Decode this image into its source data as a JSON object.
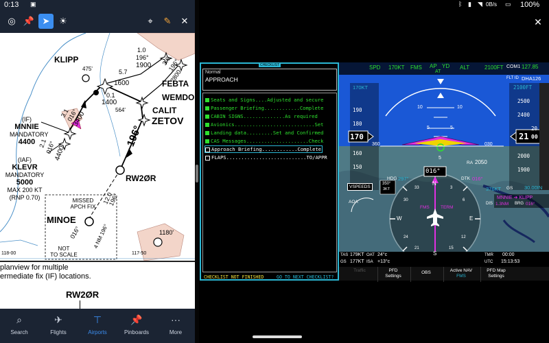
{
  "status_left": {
    "time": "0:13"
  },
  "status_right": {
    "speed": "0B/s",
    "battery": "100%"
  },
  "chart": {
    "fixes": {
      "klipp": "KLIPP",
      "febta": "FEBTA",
      "wemdo": "WEMDO",
      "calit": "CALIT",
      "zetov": "ZETOV",
      "mnnie": "MNNIE",
      "klevr": "KLEVR",
      "minoe": "MINOE",
      "rw20r": "RW2ØR"
    },
    "mnnie_block": {
      "if": "(IF)",
      "name": "MNNIE",
      "mandatory": "MANDATORY",
      "alt": "4400"
    },
    "klevr_block": {
      "iaf": "(IAF)",
      "name": "KLEVR",
      "mandatory": "MANDATORY",
      "alt": "5000",
      "max": "MAX 200 KT",
      "rnp": "(RNP 0.70)"
    },
    "labels": {
      "elev475": "475'",
      "elev564": "564'",
      "elev1180": "1180'",
      "seg_57": "5.7",
      "seg_1600": "1600",
      "seg_01": "0.1",
      "seg_1400": "1400",
      "seg_10": "1.0",
      "seg_196": "196°",
      "seg_1900": "1900",
      "seg_36": "3.6",
      "seg_196b": "196°",
      "seg_2800": "2800",
      "seg_31": "3.1",
      "seg_016a": "016°",
      "seg_3400": "3400",
      "seg_21": "2.1",
      "seg_016b": "016°",
      "seg_4400": "4400",
      "course_196": "196°",
      "seg_120": "12.0",
      "seg_196c": "196°",
      "ma_016": "016°",
      "ma_4nm": "4 NM 196°",
      "missed1": "MISSED",
      "missed2": "APCH FIX",
      "nts1": "NOT",
      "nts2": "TO SCALE",
      "lon1": "118-00",
      "lon2": "117-50"
    },
    "caption_line1": "planview for multiple",
    "caption_line2": "ermediate fix (IF) locations.",
    "caption_rw": "RW2ØR"
  },
  "nav": [
    {
      "label": "Search",
      "icon": "search-icon"
    },
    {
      "label": "Flights",
      "icon": "plane-icon"
    },
    {
      "label": "Airports",
      "icon": "airport-icon"
    },
    {
      "label": "Pinboards",
      "icon": "pin-icon"
    },
    {
      "label": "More",
      "icon": "more-icon"
    }
  ],
  "checklist": {
    "tag": "CHECKLIST",
    "phase": "Normal",
    "name": "APPROACH",
    "items": [
      {
        "text": "Seats and Signs....Adjusted and secure",
        "checked": true
      },
      {
        "text": "Passenger Briefing............Complete",
        "checked": true
      },
      {
        "text": "CABIN SIGNS..............As required",
        "checked": true
      },
      {
        "text": "Avionics...........................Set",
        "checked": true
      },
      {
        "text": "Landing data.........Set and Confirmed",
        "checked": true
      },
      {
        "text": "CAS Messages.....................Check",
        "checked": true
      },
      {
        "text": "Approach Briefing............Complete",
        "checked": false
      },
      {
        "text": "FLAPS...........................TO/APPR",
        "checked": false
      }
    ],
    "footer_left": "CHECKLIST NOT FINISHED",
    "footer_right": "GO TO NEXT CHECKLIST?"
  },
  "pfd": {
    "annunc": {
      "spd": "SPD",
      "spd_val": "170KT",
      "fms": "FMS",
      "ap": "AP",
      "yd": "YD",
      "at": "AT",
      "alt": "ALT",
      "alt_val": "2100FT"
    },
    "com1_label": "COM1",
    "com1_val": "127.85",
    "flt_id_label": "FLT ID",
    "flt_id_val": "DHA126",
    "speed_bug": "170KT",
    "airspeed_tape": [
      "190",
      "180",
      "160",
      "150"
    ],
    "airspeed_current": "170",
    "alt_tape": [
      "2500",
      "2400",
      "2000",
      "1900"
    ],
    "alt_sel": "2100FT",
    "alt_current": "21",
    "alt_roll": "00",
    "alt_roll_top": "20",
    "pitch_labels": [
      "10",
      "10",
      "5",
      "5",
      "5"
    ],
    "heading_labels": {
      "h360": "360",
      "h030": "030"
    },
    "hdg_label": "HDG",
    "hdg_val": "297°",
    "dtk_label": "DTK",
    "dtk_val": "016°",
    "ra_label": "RA",
    "ra_val": "2050",
    "current_heading": "016°",
    "vspeeds": "VSPEEDS",
    "aoa": "AOA",
    "wind_dir": "350°",
    "wind_spd": "3KT",
    "gs_label": "GS",
    "gs_val": "376KT",
    "baro": "30.00IN",
    "fms_label": "FMS",
    "term_label": "TERM",
    "nav_from": "MNNIE",
    "nav_to": "KLIPP",
    "dis_label": "DIS",
    "dis_val": "1.3NM",
    "brg_label": "BRG",
    "brg_val": "016°",
    "compass": {
      "n": "N",
      "e": "E",
      "s": "S",
      "w": "W",
      "t3": "3",
      "t6": "6",
      "t12": "12",
      "t15": "15",
      "t21": "21",
      "t24": "24",
      "t30": "30",
      "t33": "33"
    },
    "bottom": {
      "tas_label": "TAS",
      "tas_val": "179KT",
      "oat_label": "OAT",
      "oat_val": "24°c",
      "gs_label": "GS",
      "gs_val": "177KT",
      "isa_label": "ISA",
      "isa_val": "+13°c",
      "tmr_label": "TMR",
      "tmr_val": "00:00",
      "utc_label": "UTC",
      "utc_val": "15:13:53"
    }
  },
  "softkeys": [
    {
      "line1": "Traffic",
      "line2": "",
      "dim": true
    },
    {
      "line1": "PFD",
      "line2": "Settings",
      "dim": false
    },
    {
      "line1": "OBS",
      "line2": "",
      "dim": false
    },
    {
      "line1": "Active NAV",
      "line2": "FMS",
      "dim": false
    },
    {
      "line1": "PFD Map",
      "line2": "Settings",
      "dim": false
    }
  ],
  "colors": {
    "toolbar": "#1b2433",
    "accent_blue": "#3b8ef0",
    "magenta": "#e22fe2",
    "cyan": "#2bb7d4",
    "green": "#2ee02e",
    "sky": "#1a58d6",
    "ground": "#4f7a86",
    "terrain_tint": "#f3d5c9"
  }
}
